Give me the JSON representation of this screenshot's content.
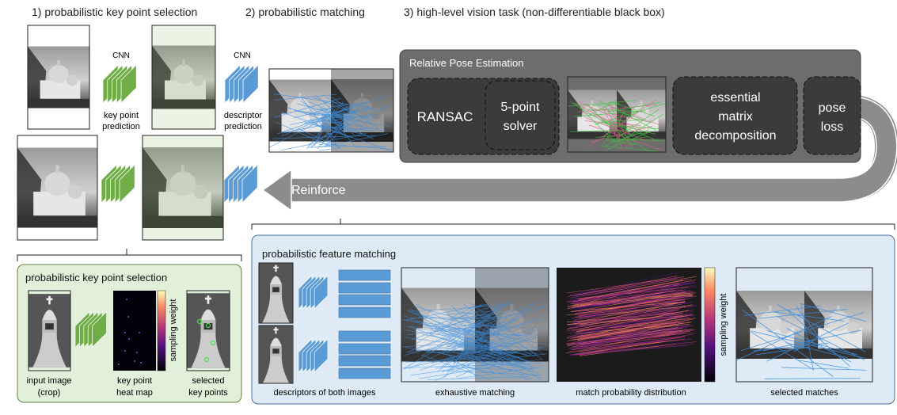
{
  "headings": {
    "step1": "1) probabilistic key point selection",
    "step2": "2) probabilistic matching",
    "step3": "3) high-level vision task (non-differentiable black box)"
  },
  "cnn": {
    "label": "CNN",
    "keypoint_caption": [
      "key point",
      "prediction"
    ],
    "descriptor_caption": [
      "descriptor",
      "prediction"
    ],
    "keypoint_color": "#70ad47",
    "descriptor_color": "#5b9bd5"
  },
  "pose_box": {
    "title": "Relative Pose Estimation",
    "ransac": "RANSAC",
    "solver": [
      "5-point",
      "solver"
    ],
    "decomposition": [
      "essential",
      "matrix",
      "decomposition"
    ],
    "loss": [
      "pose",
      "loss"
    ]
  },
  "reinforce": "Reinforce",
  "keypoint_panel": {
    "title": "probabilistic key point selection",
    "colorbar_label": "sampling weight",
    "captions": {
      "input": [
        "input image",
        "(crop)"
      ],
      "heatmap": [
        "key point",
        "heat map"
      ],
      "selected": [
        "selected",
        "key points"
      ]
    }
  },
  "matching_panel": {
    "title": "probabilistic feature matching",
    "colorbar_label": "sampling weight",
    "captions": {
      "descriptors": "descriptors of both images",
      "exhaustive": "exhaustive matching",
      "distribution": "match probability distribution",
      "selected": "selected matches"
    }
  }
}
